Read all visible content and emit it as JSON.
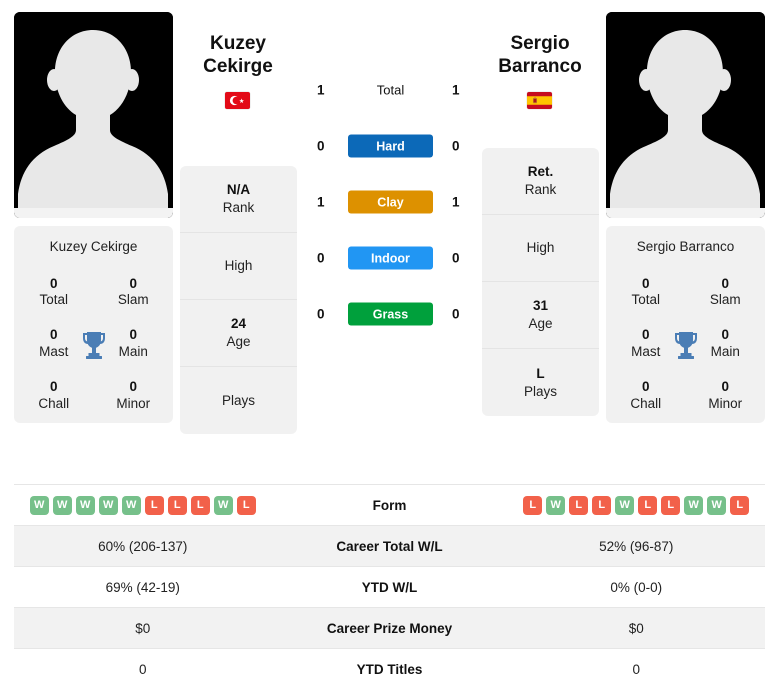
{
  "players": {
    "left": {
      "first_name": "Kuzey",
      "last_name": "Cekirge",
      "full_name": "Kuzey Cekirge",
      "flag": "turkey-flag",
      "rank": "N/A",
      "rank_label": "Rank",
      "high": "",
      "high_label": "High",
      "age": "24",
      "age_label": "Age",
      "plays": "",
      "plays_label": "Plays",
      "trophies": [
        {
          "num": "0",
          "label": "Total"
        },
        {
          "num": "0",
          "label": "Slam"
        },
        {
          "num": "0",
          "label": "Mast"
        },
        {
          "num": "0",
          "label": "Main"
        },
        {
          "num": "0",
          "label": "Chall"
        },
        {
          "num": "0",
          "label": "Minor"
        }
      ],
      "form": [
        "W",
        "W",
        "W",
        "W",
        "W",
        "L",
        "L",
        "L",
        "W",
        "L"
      ],
      "career_total_wl": "60% (206-137)",
      "ytd_wl": "69% (42-19)",
      "career_prize_money": "$0",
      "ytd_titles": "0"
    },
    "right": {
      "first_name": "Sergio",
      "last_name": "Barranco",
      "full_name": "Sergio Barranco",
      "flag": "spain-flag",
      "rank": "Ret.",
      "rank_label": "Rank",
      "high": "",
      "high_label": "High",
      "age": "31",
      "age_label": "Age",
      "plays": "L",
      "plays_label": "Plays",
      "trophies": [
        {
          "num": "0",
          "label": "Total"
        },
        {
          "num": "0",
          "label": "Slam"
        },
        {
          "num": "0",
          "label": "Mast"
        },
        {
          "num": "0",
          "label": "Main"
        },
        {
          "num": "0",
          "label": "Chall"
        },
        {
          "num": "0",
          "label": "Minor"
        }
      ],
      "form": [
        "L",
        "W",
        "L",
        "L",
        "W",
        "L",
        "L",
        "W",
        "W",
        "L"
      ],
      "career_total_wl": "52% (96-87)",
      "ytd_wl": "0% (0-0)",
      "career_prize_money": "$0",
      "ytd_titles": "0"
    }
  },
  "head_to_head": [
    {
      "label": "Total",
      "left": "1",
      "right": "1",
      "color": "",
      "style": "plain"
    },
    {
      "label": "Hard",
      "left": "0",
      "right": "0",
      "color": "#0c69b8",
      "style": "pill"
    },
    {
      "label": "Clay",
      "left": "1",
      "right": "1",
      "color": "#dd9100",
      "style": "pill"
    },
    {
      "label": "Indoor",
      "left": "0",
      "right": "0",
      "color": "#2196f3",
      "style": "pill"
    },
    {
      "label": "Grass",
      "left": "0",
      "right": "0",
      "color": "#00a03c",
      "style": "pill"
    }
  ],
  "stats_rows": [
    {
      "label": "Form",
      "type": "form"
    },
    {
      "label": "Career Total W/L",
      "type": "text",
      "key": "career_total_wl"
    },
    {
      "label": "YTD W/L",
      "type": "text",
      "key": "ytd_wl"
    },
    {
      "label": "Career Prize Money",
      "type": "text",
      "key": "career_prize_money"
    },
    {
      "label": "YTD Titles",
      "type": "text",
      "key": "ytd_titles"
    }
  ],
  "colors": {
    "win_badge": "#76c08a",
    "loss_badge": "#f2614a",
    "card_bg": "#f1f1f1",
    "row_shade": "#f2f2f2",
    "trophy": "#4a7db5"
  }
}
